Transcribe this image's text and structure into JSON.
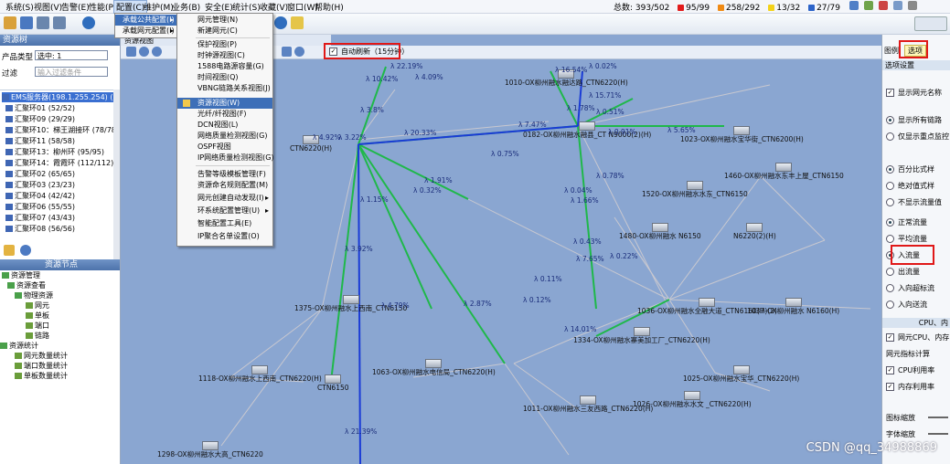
{
  "menubar": {
    "items": [
      "系统(S)",
      "视图(V)",
      "告警(E)",
      "性能(P)",
      "配置(C)",
      "维护(M)",
      "业务(B)",
      "安全(E)",
      "统计(S)",
      "收藏(V)",
      "窗口(W)",
      "帮助(H)"
    ],
    "active_index": 4
  },
  "status": {
    "prefix": "总数:",
    "total": "393/502",
    "red": "95/99",
    "orange": "258/292",
    "yellow": "13/32",
    "blue": "27/79"
  },
  "left_panel": {
    "title": "资源树",
    "product_type_label": "产品类型",
    "product_type_value": "选中: 1",
    "filter_label": "过滤",
    "filter_placeholder": "输入过滤条件",
    "tree": [
      "EMS服务器(198.1.255.254) (67/7...",
      "汇聚环01 (52/52)",
      "汇聚环09 (29/29)",
      "汇聚环10：梯王湖接环 (78/78)",
      "汇聚环11 (58/58)",
      "汇聚环13：柳州环 (95/95)",
      "汇聚环14：霞霞环 (112/112)",
      "汇聚环02 (65/65)",
      "汇聚环03 (23/23)",
      "汇聚环04 (42/42)",
      "汇聚环06 (55/55)",
      "汇聚环07 (43/43)",
      "汇聚环08 (56/56)"
    ],
    "bottom_title": "资源节点",
    "bottom_tree": [
      "资源管理",
      "资源查看",
      "物理资源",
      "网元",
      "单板",
      "端口",
      "链路",
      "资源统计",
      "网元数量统计",
      "端口数量统计",
      "单板数量统计"
    ]
  },
  "menu1": {
    "items": [
      "承载公共配置(I)",
      "承载网元配置(I)"
    ]
  },
  "menu2": {
    "items": [
      "网元管理(N)",
      "新建网元(C)",
      "保护视图(P)",
      "时钟源视图(C)",
      "1588电路源容量(G)",
      "时间视图(Q)",
      "VBNG链路关系视图(J)",
      "资源视图(W)",
      "光纤/纤视图(F)",
      "DCN视图(L)",
      "网络质量检测视图(G)",
      "OSPF视图",
      "IP网络质量检测视图(G)",
      "告警等级模板管理(F)",
      "资源命名规则配置(M)",
      "网元创建自动发现(I)",
      "环系统配置管理(U)",
      "智能配置工具(E)",
      "IP聚合名单设置(O)"
    ],
    "highlight_index": 7
  },
  "map": {
    "tab_label": "资源视图",
    "auto_refresh_label": "自动刷新（15分钟）",
    "nodes": [
      "0182-OX柳州融水融县_CT N9000(2)(H)",
      "1010-OX柳州融水融达路_CTN6220(H)",
      "1023-OX柳州融水宝华街_CTN6200(H)",
      "1460-OX柳州融水东丰上屋_CTN6150",
      "1520-OX柳州融水水东_CTN6150",
      "1480-OX柳州融水 N6150",
      "N6220(2)(H)",
      "1036-OX柳州融水全融大道_CTN6160(H)(2)",
      "1037-OX柳州融水 N6160(H)",
      "1334-OX柳州融水寨美加工厂_CTN6220(H)",
      "1375-OX柳州融水上西南_CTN6150",
      "1063-OX柳州融水电信局_CTN6220(H)",
      "1118-OX柳州融水上西南_CTN6220(H)",
      "CTN6150",
      "1011-OX柳州融水三友西路_CTN6220(H)",
      "1025-OX柳州融水宝华_CTN6220(H)",
      "1026-OX柳州融水水文 _CTN6220(H)",
      "1298-OX柳州融水大高_CTN6220",
      "CTN6220(H)"
    ],
    "labels": [
      "λ 22.19%",
      "λ 10.42%",
      "λ 4.09%",
      "λ 16.54%",
      "λ 0.02%",
      "λ 15.71%",
      "λ 1.78%",
      "λ 0.51%",
      "λ 3.8%",
      "λ 4.92%",
      "λ 3.22%",
      "λ 20.33%",
      "λ 7.47%",
      "λ 0.91%",
      "λ 5.65%",
      "λ 0.75%",
      "λ 1.91%",
      "λ 0.32%",
      "λ 1.15%",
      "λ 0.78%",
      "λ 0.04%",
      "λ 1.66%",
      "λ 0.43%",
      "λ 7.65%",
      "λ 0.22%",
      "λ 0.11%",
      "λ 0.12%",
      "λ 2.87%",
      "λ 4.79%",
      "λ 3.92%",
      "λ 14.01%",
      "λ 21.39%"
    ]
  },
  "right_panel": {
    "tabs": [
      "图例",
      "选项"
    ],
    "active_tab": 1,
    "header": "选项设置",
    "show_name": "显示网元名称",
    "link_options": [
      "显示所有链路",
      "仅显示重点监控"
    ],
    "display_options": [
      "百分比式样",
      "绝对值式样",
      "不显示流量值"
    ],
    "flow_options": [
      "正常流量",
      "平均流量",
      "入流量",
      "出流量",
      "入向超标流",
      "入向送流"
    ],
    "flow_selected": 2,
    "cpu_title": "CPU、内",
    "cpu_option1": "网元CPU、内存",
    "calc_label": "网元指标计算",
    "cpu_usage": "CPU利用率",
    "mem_usage": "内存利用率",
    "icon_size_label": "图标缩放",
    "font_size_label": "字体缩放"
  },
  "watermark": "CSDN @qq_34988869",
  "colors": {
    "map_bg": "#8aa6d1",
    "link_green": "#1fb84a",
    "link_blue": "#1a3bd6",
    "link_gray": "#c8c8d0",
    "highlight_red": "#e01818",
    "menu_highlight": "#3d6fb8"
  }
}
